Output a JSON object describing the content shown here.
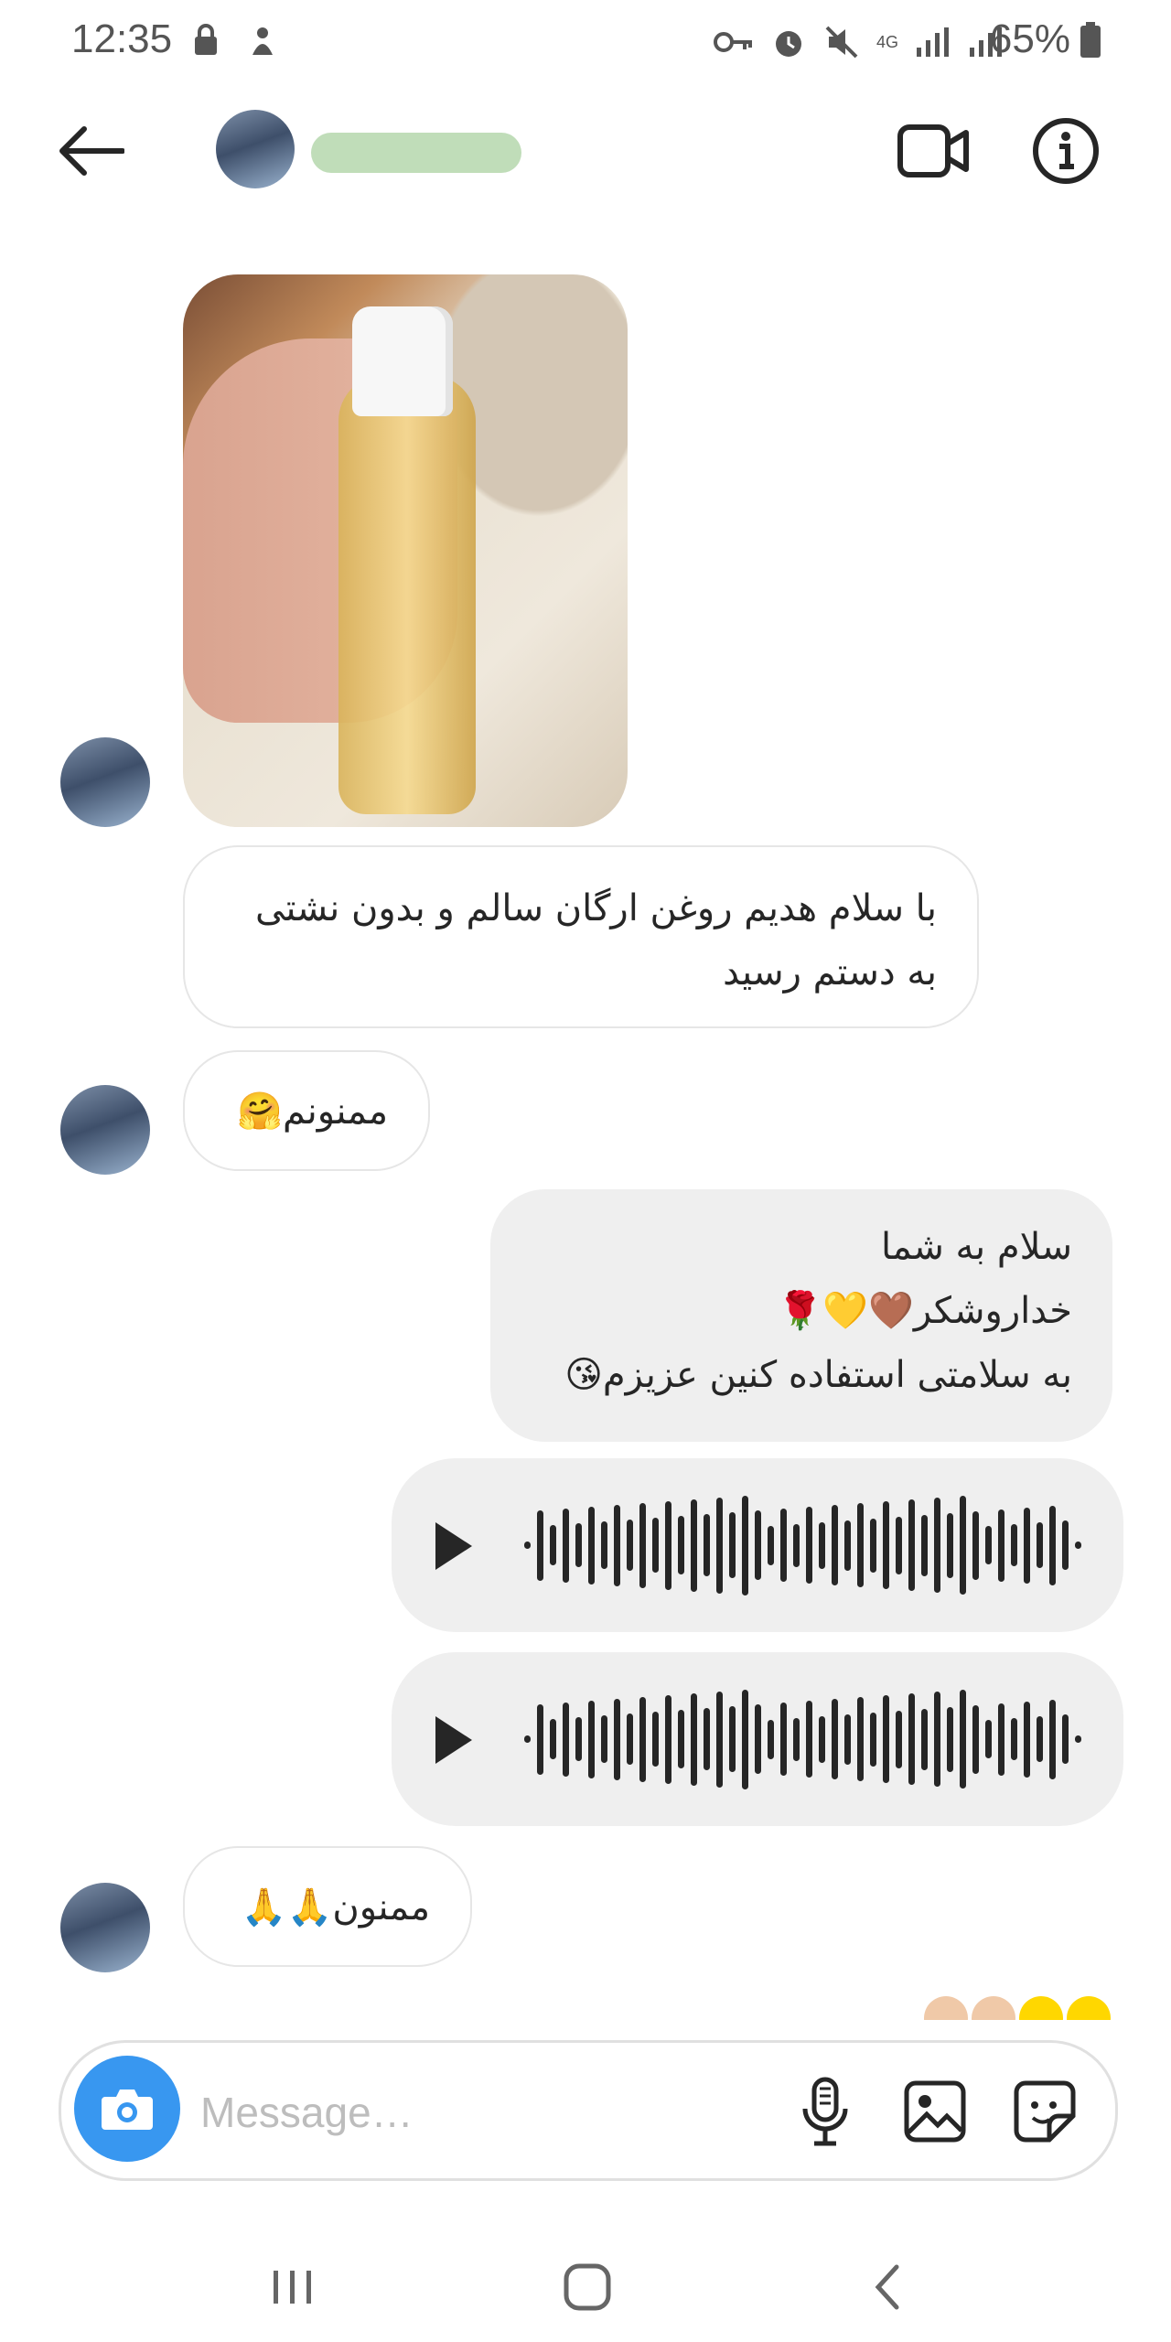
{
  "status_bar": {
    "time": "12:35",
    "battery": "65%",
    "network": "4G"
  },
  "header": {
    "contact_name": "",
    "back": "back-arrow-icon",
    "video_call": "video-camera-icon",
    "info": "info-icon"
  },
  "messages": [
    {
      "from": "them",
      "type": "image"
    },
    {
      "from": "them",
      "type": "text",
      "lines": [
        "با سلام هدیم روغن ارگان سالم و بدون نشتی",
        "به دستم رسید"
      ]
    },
    {
      "from": "them",
      "type": "text",
      "lines": [
        "ممنونم🤗"
      ]
    },
    {
      "from": "me",
      "type": "text",
      "lines": [
        "سلام به شما",
        "خداروشکر🤎💛🌹",
        "به سلامتی استفاده کنین عزیزم😘"
      ]
    },
    {
      "from": "me",
      "type": "voice"
    },
    {
      "from": "me",
      "type": "voice"
    },
    {
      "from": "them",
      "type": "text",
      "lines": [
        "ممنون🙏🙏"
      ]
    }
  ],
  "composer": {
    "placeholder": "Message…",
    "icons": [
      "camera-icon",
      "microphone-icon",
      "gallery-icon",
      "sticker-icon"
    ]
  },
  "colors": {
    "accent": "#3897f0",
    "outgoing_bubble": "#efefef",
    "incoming_border": "#e6e6e6"
  }
}
